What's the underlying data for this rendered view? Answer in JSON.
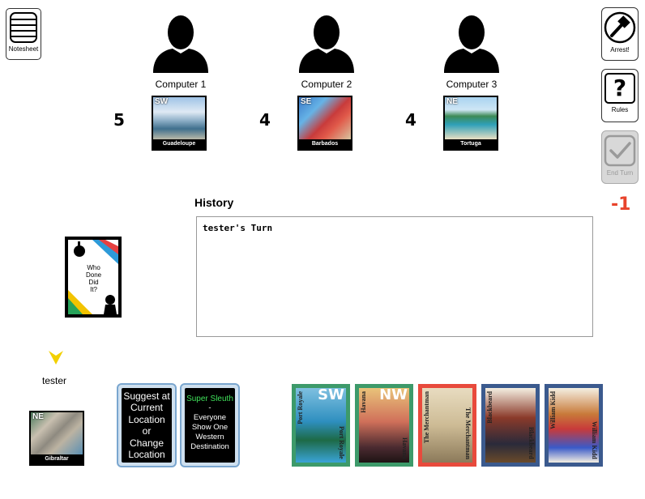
{
  "toolbar": {
    "notesheet_label": "Notesheet",
    "arrest_label": "Arrest!",
    "rules_label": "Rules",
    "end_turn_label": "End Turn",
    "rules_icon_glyph": "?"
  },
  "players": [
    {
      "name": "Computer 1",
      "count": "5",
      "card": {
        "dir": "SW",
        "name": "Guadeloupe"
      }
    },
    {
      "name": "Computer 2",
      "count": "4",
      "card": {
        "dir": "SE",
        "name": "Barbados"
      }
    },
    {
      "name": "Computer 3",
      "count": "4",
      "card": {
        "dir": "NE",
        "name": "Tortuga"
      }
    }
  ],
  "history": {
    "title": "History",
    "entries": [
      "tester's Turn"
    ]
  },
  "score_delta": "-1",
  "deck": {
    "text_lines": [
      "Who",
      "Done",
      "Did",
      "It?"
    ]
  },
  "current_player": {
    "name": "tester",
    "card": {
      "dir": "NE",
      "name": "Gibraltar"
    }
  },
  "actions": {
    "suggest": [
      "Suggest at",
      "Current",
      "Location",
      "or",
      "Change",
      "Location"
    ],
    "super_sleuth": {
      "title": "Super Sleuth",
      "lines": [
        "-",
        "Everyone",
        "Show One",
        "Western",
        "Destination"
      ]
    }
  },
  "hand": [
    {
      "kind": "location",
      "dir": "SW",
      "left_text": "Port Royale",
      "right_text": "Port Royale",
      "border": "#3d9a6a"
    },
    {
      "kind": "location",
      "dir": "NW",
      "left_text": "Havana",
      "right_text": "Havana",
      "border": "#3d9a6a"
    },
    {
      "kind": "ship",
      "left_text": "The Merchantman",
      "right_text": "The Merchantman",
      "border": "#e84a3c"
    },
    {
      "kind": "pirate",
      "left_text": "Blackbeard",
      "right_text": "Blackbeard",
      "border": "#3b5a8e"
    },
    {
      "kind": "pirate",
      "left_text": "William Kidd",
      "right_text": "William Kidd",
      "border": "#3b5a8e"
    }
  ],
  "colors": {
    "accent_red": "#e8442c",
    "turn_indicator": "#f2d000",
    "action_card_border": "#7aa6cf",
    "super_sleuth_title": "#3fe05a"
  }
}
